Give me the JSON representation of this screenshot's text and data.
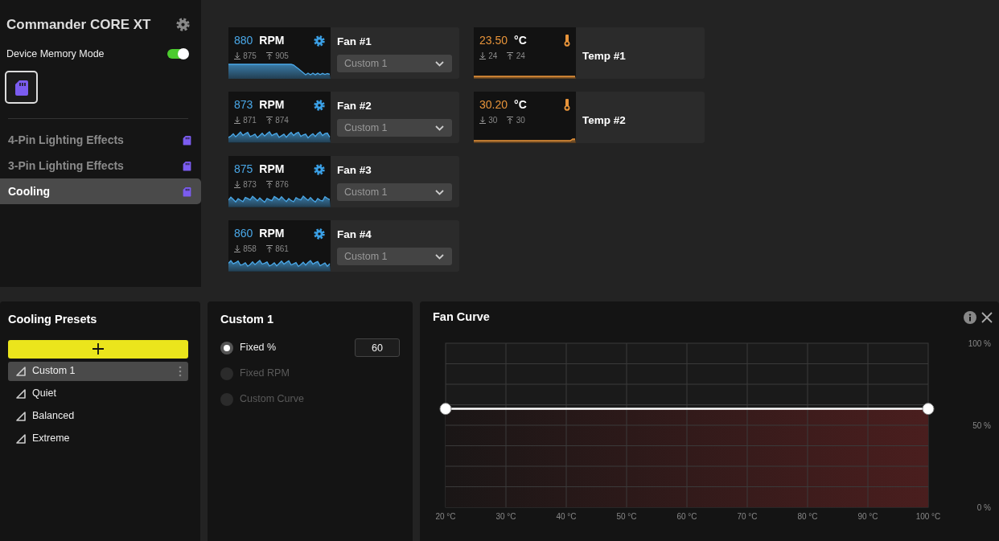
{
  "sidebar": {
    "title": "Commander CORE XT",
    "memory_mode": {
      "label": "Device Memory Mode",
      "on": true
    },
    "nav": [
      {
        "label": "4-Pin Lighting Effects",
        "selected": false
      },
      {
        "label": "3-Pin Lighting Effects",
        "selected": false
      },
      {
        "label": "Cooling",
        "selected": true
      }
    ]
  },
  "fans": [
    {
      "reading": "880",
      "unit": "RPM",
      "min": "875",
      "max": "905",
      "name": "Fan #1",
      "preset": "Custom 1"
    },
    {
      "reading": "873",
      "unit": "RPM",
      "min": "871",
      "max": "874",
      "name": "Fan #2",
      "preset": "Custom 1"
    },
    {
      "reading": "875",
      "unit": "RPM",
      "min": "873",
      "max": "876",
      "name": "Fan #3",
      "preset": "Custom 1"
    },
    {
      "reading": "860",
      "unit": "RPM",
      "min": "858",
      "max": "861",
      "name": "Fan #4",
      "preset": "Custom 1"
    }
  ],
  "temps": [
    {
      "reading": "23.50",
      "unit": "°C",
      "min": "24",
      "max": "24",
      "name": "Temp #1"
    },
    {
      "reading": "30.20",
      "unit": "°C",
      "min": "30",
      "max": "30",
      "name": "Temp #2"
    }
  ],
  "presets": {
    "title": "Cooling Presets",
    "items": [
      {
        "label": "Custom 1",
        "selected": true
      },
      {
        "label": "Quiet",
        "selected": false
      },
      {
        "label": "Balanced",
        "selected": false
      },
      {
        "label": "Extreme",
        "selected": false
      }
    ]
  },
  "preset_detail": {
    "title": "Custom 1",
    "modes": [
      {
        "label": "Fixed %",
        "selected": true,
        "disabled": false,
        "value": "60"
      },
      {
        "label": "Fixed RPM",
        "selected": false,
        "disabled": true
      },
      {
        "label": "Custom Curve",
        "selected": false,
        "disabled": true
      }
    ]
  },
  "fan_curve": {
    "title": "Fan Curve",
    "chart_data": {
      "type": "area",
      "grid": true,
      "x": [
        20,
        100
      ],
      "series": [
        {
          "color": "#ffffff",
          "values": [
            60,
            60
          ]
        }
      ],
      "xlim": [
        20,
        100
      ],
      "ylim": [
        0,
        100
      ],
      "xticks": [
        {
          "value": 20,
          "label": "20 °C"
        },
        {
          "value": 30,
          "label": "30 °C"
        },
        {
          "value": 40,
          "label": "40 °C"
        },
        {
          "value": 50,
          "label": "50 °C"
        },
        {
          "value": 60,
          "label": "60 °C"
        },
        {
          "value": 70,
          "label": "70 °C"
        },
        {
          "value": 80,
          "label": "80 °C"
        },
        {
          "value": 90,
          "label": "90 °C"
        },
        {
          "value": 100,
          "label": "100 °C"
        }
      ],
      "yticks": [
        {
          "value": 0,
          "label": "0 %"
        },
        {
          "value": 50,
          "label": "50 %"
        },
        {
          "value": 100,
          "label": "100 %"
        }
      ]
    }
  }
}
